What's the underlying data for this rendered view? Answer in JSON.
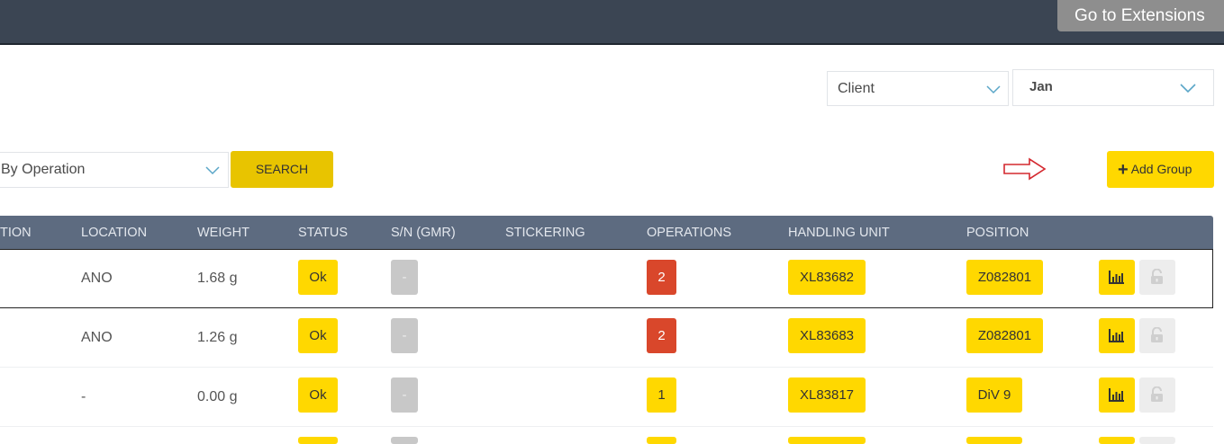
{
  "topbar": {
    "extensions_label": "Go to Extensions"
  },
  "filters": {
    "client": "Client",
    "month": "Jan",
    "mode": "By Operation",
    "search_label": "SEARCH",
    "add_group_label": "Add Group"
  },
  "table": {
    "headers": [
      "TION",
      "LOCATION",
      "WEIGHT",
      "STATUS",
      "S/N (GMR)",
      "STICKERING",
      "OPERATIONS",
      "HANDLING UNIT",
      "POSITION"
    ],
    "rows": [
      {
        "location": "ANO",
        "weight": "1.68 g",
        "status": "Ok",
        "sn": "-",
        "operations": "2",
        "handling_unit": "XL83682",
        "position": "Z082801"
      },
      {
        "location": "ANO",
        "weight": "1.26 g",
        "status": "Ok",
        "sn": "-",
        "operations": "2",
        "handling_unit": "XL83683",
        "position": "Z082801"
      },
      {
        "location": "-",
        "weight": "0.00 g",
        "status": "Ok",
        "sn": "-",
        "operations": "1",
        "handling_unit": "XL83817",
        "position": "DiV 9"
      }
    ]
  },
  "colors": {
    "header_bg": "#3b4553",
    "accent_yellow": "#ffd800",
    "ops_red": "#d9472b",
    "table_head": "#5d6b80"
  },
  "icons": {
    "chart": "bar-chart-icon",
    "lock": "unlock-icon",
    "chevron": "chevron-down-icon",
    "arrow": "arrow-right-outline-icon"
  }
}
